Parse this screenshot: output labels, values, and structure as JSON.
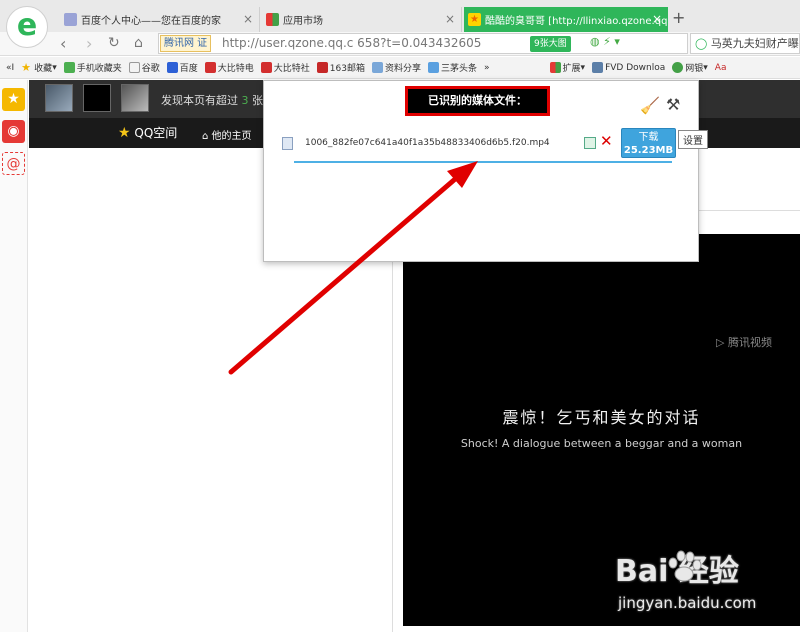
{
  "browser": {
    "tabs": [
      {
        "label": "百度个人中心——您在百度的家",
        "close": "×"
      },
      {
        "label": "应用市场",
        "close": "×"
      },
      {
        "label": "酷酷的臭哥哥 [http://llinxiao.qzone.qq.",
        "close": "×"
      }
    ],
    "new_tab": "+",
    "nav": {
      "back": "‹",
      "forward": "›",
      "reload": "↻",
      "home": "⌂"
    },
    "address": {
      "badge": "腾讯网 证",
      "url": "http://user.qzone.qq.c          658?t=0.043432605",
      "big_label": "9张大图",
      "search_text": "马英九夫妇财产曝"
    },
    "bookmarks": [
      "«I",
      "收藏",
      "手机收藏夹",
      "谷歌",
      "百度",
      "大比特电",
      "大比特社",
      "163邮箱",
      "资料分享",
      "三茅头条",
      "»",
      "扩展",
      "FVD Downloa",
      "网银",
      "Aa"
    ]
  },
  "qzone": {
    "notice_prefix": "发现本页有超过",
    "notice_number": "3",
    "notice_suffix": "张",
    "logo": "QQ空间",
    "home_link": "他的主页"
  },
  "popup": {
    "title": "已识别的媒体文件：",
    "file_name": "1006_882fe07c641a40f1a35b48833406d6b5.f20.mp4",
    "download_label": "下载",
    "download_size": "25.23MB",
    "tooltip": "设置"
  },
  "video": {
    "brand": "腾讯视频",
    "caption_cn": "震惊！乞丐和美女的对话",
    "caption_en": "Shock! A dialogue between a beggar and a woman"
  },
  "watermark": {
    "logo": "Bai  经验",
    "url": "jingyan.baidu.com"
  },
  "colors": {
    "accent_green": "#2fb65a",
    "annotation_red": "#e00000",
    "download_blue": "#3fa4dd"
  }
}
